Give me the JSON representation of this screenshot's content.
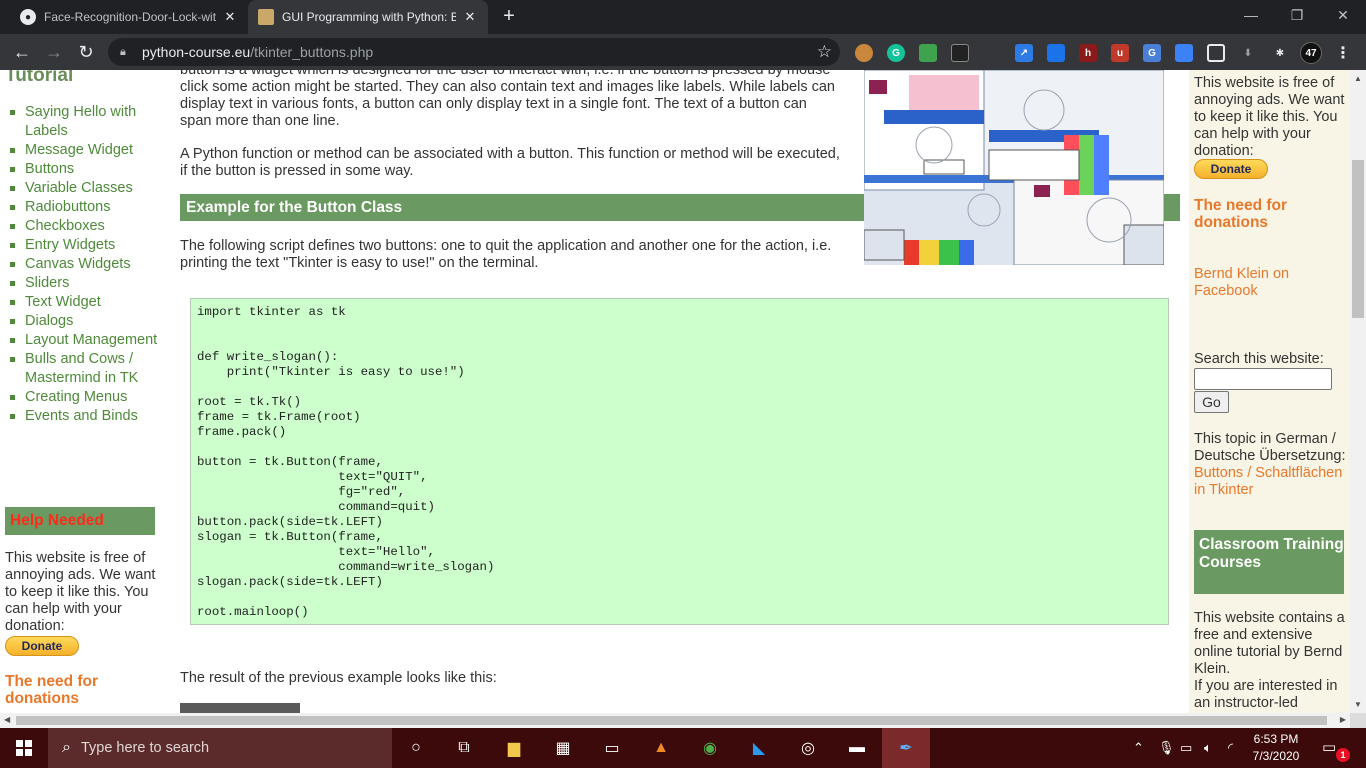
{
  "browser": {
    "tabs": [
      {
        "title": "Face-Recognition-Door-Lock-wit",
        "close": "✕"
      },
      {
        "title": "GUI Programming with Python: B",
        "close": "✕"
      }
    ],
    "new_tab": "+",
    "window_controls": {
      "minimize": "—",
      "restore": "❐",
      "close": "✕"
    },
    "url_host": "python-course.eu",
    "url_path": "/tkinter_buttons.php",
    "extensions_count": "47"
  },
  "left_sidebar": {
    "heading": "Tutorial",
    "items": [
      "Saying Hello with Labels",
      "Message Widget",
      "Buttons",
      "Variable Classes",
      "Radiobuttons",
      "Checkboxes",
      "Entry Widgets",
      "Canvas Widgets",
      "Sliders",
      "Text Widget",
      "Dialogs",
      "Layout Management",
      "Bulls and Cows / Mastermind in TK",
      "Creating Menus",
      "Events and Binds"
    ],
    "help_heading": "Help Needed",
    "free_text": "This website is free of annoying ads. We want to keep it like this. You can help with your donation:",
    "donate_label": "Donate",
    "need_heading": "The need for donations"
  },
  "main": {
    "intro_1": "button is a widget which is designed for the user to interact with, i.e. if the button is pressed by mouse click some action might be started. They can also contain text and images like labels. While labels can display text in various fonts, a button can only display text in a single font. The text of a button can span more than one line.",
    "intro_2": "A Python function or method can be associated with a button. This function or method will be executed, if the button is pressed in some way.",
    "section_heading": "Example for the Button Class",
    "script_desc": "The following script defines two buttons: one to quit the application and another one for the action, i.e. printing the text \"Tkinter is easy to use!\" on the terminal.",
    "code": "import tkinter as tk\n\n\ndef write_slogan():\n    print(\"Tkinter is easy to use!\")\n\nroot = tk.Tk()\nframe = tk.Frame(root)\nframe.pack()\n\nbutton = tk.Button(frame,\n                   text=\"QUIT\",\n                   fg=\"red\",\n                   command=quit)\nbutton.pack(side=tk.LEFT)\nslogan = tk.Button(frame,\n                   text=\"Hello\",\n                   command=write_slogan)\nslogan.pack(side=tk.LEFT)\n\nroot.mainloop()",
    "result_text": "The result of the previous example looks like this:"
  },
  "right_sidebar": {
    "free_text": "This website is free of annoying ads. We want to keep it like this. You can help with your donation:",
    "donate_label": "Donate",
    "need_heading": "The need for donations",
    "facebook_link": "Bernd Klein on Facebook",
    "search_label": "Search this website:",
    "search_value": "",
    "go_label": "Go",
    "german_text": "This topic in German / Deutsche Übersetzung:",
    "german_link": "Buttons / Schaltflächen in Tkinter",
    "classroom_heading": "Classroom Training Courses",
    "contains_text": "This website contains a free and extensive online tutorial by Bernd Klein.",
    "interested_text": "If you are interested in an instructor-led"
  },
  "taskbar": {
    "search_placeholder": "Type here to search",
    "time": "6:53 PM",
    "date": "7/3/2020",
    "notification_count": "1"
  }
}
